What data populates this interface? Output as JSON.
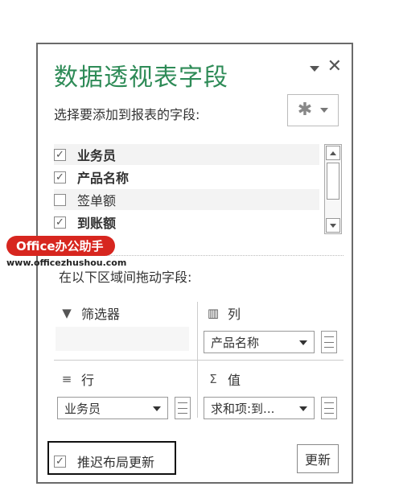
{
  "pane": {
    "title": "数据透视表字段",
    "choose_label": "选择要添加到报表的字段:",
    "fields": [
      {
        "label": "业务员",
        "checked": true,
        "check_glyph": "✓",
        "bold": true
      },
      {
        "label": "产品名称",
        "checked": true,
        "check_glyph": "✓",
        "bold": true
      },
      {
        "label": "签单额",
        "checked": false,
        "check_glyph": "",
        "bold": false
      },
      {
        "label": "到账额",
        "checked": true,
        "check_glyph": "✓",
        "bold": true
      }
    ],
    "drag_label": "在以下区域间拖动字段:",
    "areas": {
      "filters": {
        "label": "筛选器",
        "icon": "filter-icon",
        "glyph": "▼"
      },
      "columns": {
        "label": "列",
        "icon": "columns-icon",
        "glyph": "▥",
        "item": "产品名称"
      },
      "rows": {
        "label": "行",
        "icon": "rows-icon",
        "glyph": "≡",
        "item": "业务员"
      },
      "values": {
        "label": "值",
        "icon": "sigma-icon",
        "glyph": "Σ",
        "item": "求和项:到..."
      }
    },
    "defer_update": {
      "label": "推迟布局更新",
      "checked": true,
      "check_glyph": "✓"
    },
    "update_button": "更新",
    "close_glyph": "✕",
    "gear_glyph": "✱"
  },
  "watermark": {
    "brand": "Office办公助手",
    "url": "www.officezhushou.com"
  },
  "colors": {
    "title": "#2e8b57",
    "watermark_red": "#d7261f"
  }
}
